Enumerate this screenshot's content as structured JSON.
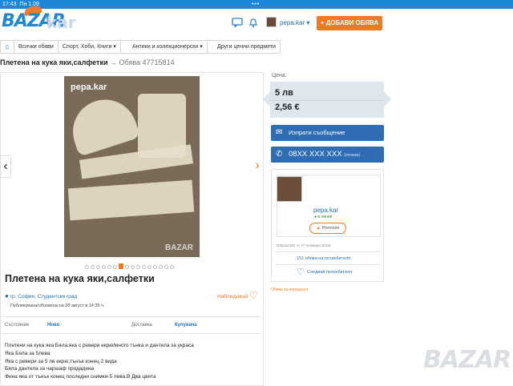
{
  "status_bar": {
    "time": "17:43",
    "date": "Пн 1.09",
    "dots": "•••"
  },
  "header": {
    "logo_main": "BAZAR",
    "logo_tail": "kar",
    "user_name": "pepa.kar ▾",
    "add_button": "+ ДОБАВИ ОБЯВА"
  },
  "breadcrumb": {
    "items": [
      "Всички обяви",
      "Спорт, Хоби, Книги ▾",
      "Антики и колекционерски ▾",
      "Други ценни предмети"
    ]
  },
  "listing": {
    "title": "Плетена на кука яки,салфетки",
    "id_text": "→ Обява 47715814",
    "watermark_top": "pepa.kar",
    "watermark_bottom": "BAZAR",
    "heading": "Плетена на кука яки,салфетки",
    "location": "гр. София, Студентски град",
    "favorite_label": "Наблюдавай",
    "published": "Публикувана/обновена на 28 август в 14:35 ч.",
    "properties": [
      {
        "label": "Състояние",
        "value": "Ново"
      },
      {
        "label": "Доставка",
        "value": "Купувача"
      }
    ],
    "gallery_count": 16,
    "gallery_active_index": 6,
    "description": [
      "Плетени на кука яка Бяла,яка с ревери екрю/много тънка и дантела за украса",
      "Яка Бяла за 5лева",
      "Яка с ревери за 5 лв екрю,тънък конец 2 вида",
      "Бяла дантела за чаршаф продадена",
      "Фина яка от тънък конец последни снимки-5 лева.В Два цвята"
    ]
  },
  "price": {
    "label": "Цена:",
    "lv": "5 лв",
    "eur": "2,56 €"
  },
  "contact": {
    "message_button": "Изпрати съобщение",
    "phone": "08XX XXX XXX",
    "phone_show": "(покажи)"
  },
  "seller": {
    "name": "pepa.kar",
    "online": "● в линия",
    "badge": "Premium",
    "member_since": "В Bazar.BG от 17 ноември 2015г.",
    "ads_link": "151 обяви на потребителя",
    "follow": "Следвай потребителя"
  },
  "report_link": "Обява за нередност",
  "watermark": "BAZAR",
  "colors": {
    "brand_blue": "#1f87d8",
    "accent_orange": "#f4781f",
    "button_blue": "#2e6db4"
  },
  "icons": [
    "home-icon",
    "chat-icon",
    "bell-icon",
    "heart-icon",
    "location-pin-icon",
    "envelope-icon",
    "phone-icon",
    "chevron-left-icon",
    "chevron-right-icon"
  ]
}
